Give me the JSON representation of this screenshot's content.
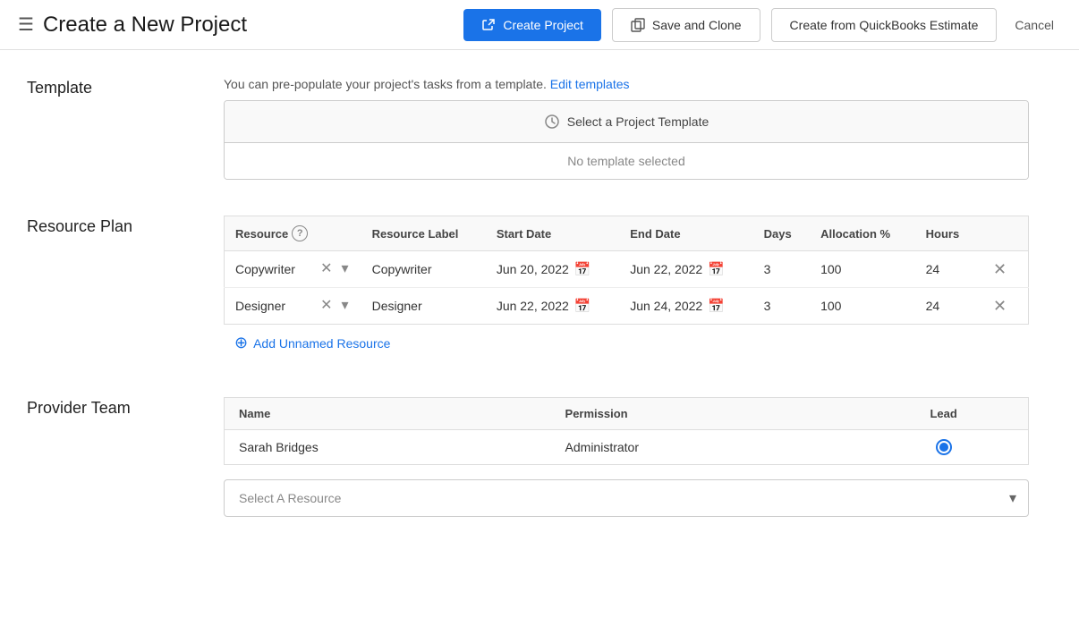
{
  "header": {
    "icon": "☰",
    "title": "Create a New Project",
    "create_project_label": "Create Project",
    "save_clone_label": "Save and Clone",
    "quickbooks_label": "Create from QuickBooks Estimate",
    "cancel_label": "Cancel"
  },
  "template_section": {
    "label": "Template",
    "hint_text": "You can pre-populate your project's tasks from a template.",
    "edit_templates_label": "Edit templates",
    "select_btn_label": "Select a Project Template",
    "no_template_text": "No template selected"
  },
  "resource_plan_section": {
    "label": "Resource Plan",
    "columns": {
      "resource": "Resource",
      "resource_label": "Resource Label",
      "start_date": "Start Date",
      "end_date": "End Date",
      "days": "Days",
      "allocation": "Allocation %",
      "hours": "Hours"
    },
    "rows": [
      {
        "resource": "Copywriter",
        "resource_label": "Copywriter",
        "start_date": "Jun 20, 2022",
        "end_date": "Jun 22, 2022",
        "days": "3",
        "allocation": "100",
        "hours": "24"
      },
      {
        "resource": "Designer",
        "resource_label": "Designer",
        "start_date": "Jun 22, 2022",
        "end_date": "Jun 24, 2022",
        "days": "3",
        "allocation": "100",
        "hours": "24"
      }
    ],
    "add_resource_label": "Add Unnamed Resource"
  },
  "provider_team_section": {
    "label": "Provider Team",
    "columns": {
      "name": "Name",
      "permission": "Permission",
      "lead": "Lead"
    },
    "rows": [
      {
        "name": "Sarah Bridges",
        "permission": "Administrator",
        "is_lead": true
      }
    ],
    "select_resource_placeholder": "Select A Resource"
  }
}
